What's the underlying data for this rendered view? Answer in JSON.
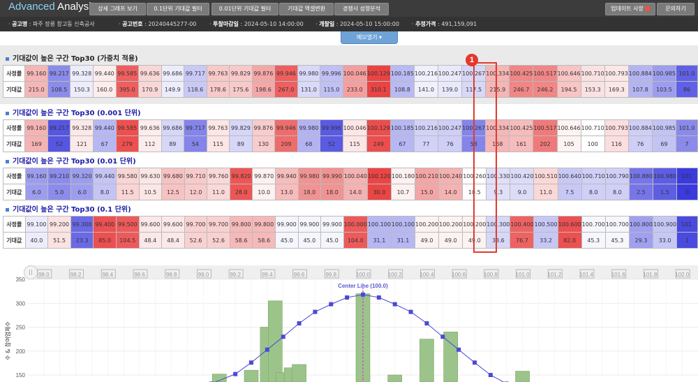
{
  "app": {
    "logo_a": "Advanced",
    "logo_b": " Analysis"
  },
  "nav": [
    {
      "label": "상세 그래프 보기"
    },
    {
      "label": "0.1단위 기대값 필터"
    },
    {
      "label": "0.01단위 기대값 필터"
    },
    {
      "label": "기대값 엑셀변환"
    },
    {
      "label": "경쟁사 성향분석"
    }
  ],
  "nav_right": [
    {
      "label": "업데이트 사항"
    },
    {
      "label": "문의하기"
    }
  ],
  "info": [
    {
      "k": "공고명",
      "v": "파주 장릉 창고동 신축공사"
    },
    {
      "k": "공고번호",
      "v": "20240445277-00"
    },
    {
      "k": "투찰마감일",
      "v": "2024-05-10 14:00:00"
    },
    {
      "k": "개찰일",
      "v": "2024-05-10 15:00:00"
    },
    {
      "k": "추정가격",
      "v": "491,159,091"
    }
  ],
  "memo": "메모열기",
  "row_labels": {
    "rate": "사정률",
    "exp": "기대값"
  },
  "sections": [
    {
      "title": "기대값이 높은 구간 Top30 (가중치 적용)",
      "blue": false,
      "rates": [
        "99.160",
        "99.217",
        "99.328",
        "99.440",
        "99.585",
        "99.636",
        "99.686",
        "99.717",
        "99.763",
        "99.829",
        "99.876",
        "99.946",
        "99.980",
        "99.996",
        "100.046",
        "100.129",
        "100.185",
        "100.216",
        "100.247",
        "100.267",
        "100.334",
        "100.425",
        "100.517",
        "100.646",
        "100.710",
        "100.793",
        "100.884",
        "100.985",
        "101.0"
      ],
      "exps": [
        "215.0",
        "108.5",
        "150.3",
        "160.0",
        "395.0",
        "170.9",
        "149.9",
        "118.6",
        "178.6",
        "175.6",
        "198.6",
        "267.0",
        "131.0",
        "115.0",
        "233.0",
        "310.1",
        "108.8",
        "141.0",
        "139.0",
        "117.5",
        "215.9",
        "246.7",
        "246.2",
        "194.5",
        "153.3",
        "169.3",
        "107.8",
        "103.5",
        "86"
      ],
      "colors": [
        "#f4b6b6",
        "#8b8bea",
        "#ececfc",
        "#fcecec",
        "#ee5f5f",
        "#f9d7d7",
        "#ececfc",
        "#c9c9f7",
        "#f8c9c9",
        "#f8c9c9",
        "#f4a7a7",
        "#ee5f5f",
        "#d9d9f9",
        "#c0c0f5",
        "#f49e9e",
        "#e94444",
        "#b9b9f4",
        "#f0f0fd",
        "#e9e9fc",
        "#d7d7f8",
        "#f4b6b6",
        "#f08686",
        "#f08686",
        "#f8c4c4",
        "#f9e2e2",
        "#fbe7e7",
        "#b4b4f3",
        "#9d9df0",
        "#6060e6"
      ]
    },
    {
      "title": "기대값이 높은 구간 Top30 (0.001 단위)",
      "blue": true,
      "rates": [
        "99.160",
        "99.217",
        "99.328",
        "99.440",
        "99.585",
        "99.636",
        "99.686",
        "99.717",
        "99.763",
        "99.829",
        "99.876",
        "99.946",
        "99.980",
        "99.996",
        "100.046",
        "100.129",
        "100.185",
        "100.216",
        "100.247",
        "100.267",
        "100.334",
        "100.425",
        "100.517",
        "100.646",
        "100.710",
        "100.793",
        "100.884",
        "100.985",
        "101.0"
      ],
      "exps": [
        "169",
        "52",
        "121",
        "67",
        "279",
        "112",
        "89",
        "54",
        "115",
        "89",
        "130",
        "209",
        "68",
        "52",
        "115",
        "249",
        "67",
        "77",
        "76",
        "58",
        "168",
        "161",
        "202",
        "105",
        "100",
        "116",
        "76",
        "69",
        "7"
      ],
      "colors": [
        "#f5b3b3",
        "#5656e2",
        "#fbe9e9",
        "#b7b7f3",
        "#ee4f4f",
        "#fcecec",
        "#d6d6f8",
        "#8484eb",
        "#fde6e6",
        "#d6d6f8",
        "#f8cccc",
        "#ef6c6c",
        "#b3b3f3",
        "#5a5ae3",
        "#fde6e6",
        "#ec4d4d",
        "#b7b7f3",
        "#d2d2f8",
        "#cecef7",
        "#8484eb",
        "#f5b7b7",
        "#f6bcbc",
        "#f07a7a",
        "#fdf3f3",
        "#ffffff",
        "#fcdede",
        "#cecef7",
        "#c3c3f5",
        "#8a8aea"
      ]
    },
    {
      "title": "기대값이 높은 구간 Top30 (0.01 단위)",
      "blue": true,
      "rates": [
        "99.160",
        "99.210",
        "99.320",
        "99.440",
        "99.580",
        "99.630",
        "99.680",
        "99.710",
        "99.760",
        "99.820",
        "99.870",
        "99.940",
        "99.980",
        "99.990",
        "100.040",
        "100.120",
        "100.180",
        "100.210",
        "100.240",
        "100.260",
        "100.330",
        "100.420",
        "100.510",
        "100.640",
        "100.710",
        "100.790",
        "100.880",
        "100.980",
        "101."
      ],
      "exps": [
        "6.0",
        "5.0",
        "6.0",
        "8.0",
        "11.5",
        "10.5",
        "12.5",
        "12.0",
        "11.0",
        "28.0",
        "10.0",
        "13.0",
        "18.0",
        "18.0",
        "14.0",
        "30.0",
        "10.7",
        "15.0",
        "14.0",
        "10.5",
        "9.3",
        "9.0",
        "11.0",
        "7.5",
        "8.0",
        "8.0",
        "2.5",
        "1.5",
        "0"
      ],
      "colors": [
        "#9d9def",
        "#8c8cec",
        "#9d9def",
        "#c4c4f5",
        "#f9d5d5",
        "#fbe6e6",
        "#f7c2c2",
        "#f8caca",
        "#fad8d8",
        "#ee5555",
        "#fdf1f1",
        "#f7bcbc",
        "#f19393",
        "#f19393",
        "#f5b2b2",
        "#eb4545",
        "#fdf0f0",
        "#f4a6a6",
        "#f5b2b2",
        "#ffffff",
        "#e0e0fa",
        "#dcdcf9",
        "#fad8d8",
        "#c8c8f6",
        "#cfcff7",
        "#cfcff7",
        "#7676e9",
        "#5e5ee4",
        "#3a3ade"
      ]
    },
    {
      "title": "기대값이 높은 구간 Top30 (0.1 단위)",
      "blue": true,
      "rates": [
        "99.100",
        "99.200",
        "99.300",
        "99.400",
        "99.500",
        "99.600",
        "99.600",
        "99.700",
        "99.700",
        "99.800",
        "99.800",
        "99.900",
        "99.900",
        "99.900",
        "100.000",
        "100.100",
        "100.100",
        "100.200",
        "100.200",
        "100.200",
        "100.300",
        "100.400",
        "100.500",
        "100.600",
        "100.700",
        "100.700",
        "100.800",
        "100.900",
        "101."
      ],
      "exps": [
        "40.0",
        "51.5",
        "23.3",
        "85.0",
        "104.5",
        "48.4",
        "48.4",
        "52.6",
        "52.6",
        "58.6",
        "58.6",
        "45.0",
        "45.0",
        "45.0",
        "104.0",
        "31.1",
        "31.1",
        "49.0",
        "49.0",
        "49.0",
        "38.6",
        "76.7",
        "33.2",
        "82.0",
        "45.3",
        "45.3",
        "29.3",
        "33.0",
        "1"
      ],
      "colors": [
        "#ececfc",
        "#fbe3e3",
        "#6a6ae6",
        "#ec5050",
        "#ee5a5a",
        "#fbe8e8",
        "#fbe8e8",
        "#f9d1d1",
        "#f9d1d1",
        "#f6b9b9",
        "#f6b9b9",
        "#f5f5fd",
        "#f5f5fd",
        "#f5f5fd",
        "#ee5a5a",
        "#b7b7f3",
        "#b7b7f3",
        "#fdf2f2",
        "#fdf2f2",
        "#fdf2f2",
        "#d7d7f8",
        "#ee6262",
        "#c7c7f6",
        "#ec5050",
        "#f6f6fd",
        "#f6f6fd",
        "#a0a0f0",
        "#c7c7f6",
        "#4a4ae0"
      ]
    }
  ],
  "badge": "1",
  "chart_data": {
    "type": "bar",
    "annotations": [
      "Center Line (100.0)"
    ],
    "ylim": [
      150,
      350
    ],
    "y_ticks": [
      "350",
      "300",
      "250",
      "200",
      "150"
    ],
    "mini_ticks": [
      "98.0",
      "98.2",
      "98.4",
      "98.6",
      "98.8",
      "99.0",
      "99.2",
      "99.4",
      "99.6",
      "99.8",
      "100.0",
      "100.2",
      "100.4",
      "100.6",
      "100.8",
      "101.0",
      "101.2",
      "101.4",
      "101.6",
      "101.8",
      "102.0"
    ],
    "ylabel_vertical": "수 & 참여업체수",
    "bars": [
      {
        "x": 99.1,
        "v": 152
      },
      {
        "x": 99.3,
        "v": 160
      },
      {
        "x": 99.4,
        "v": 250
      },
      {
        "x": 99.45,
        "v": 305
      },
      {
        "x": 99.5,
        "v": 155
      },
      {
        "x": 99.55,
        "v": 165
      },
      {
        "x": 99.6,
        "v": 172
      },
      {
        "x": 100.0,
        "v": 320
      },
      {
        "x": 100.2,
        "v": 150
      },
      {
        "x": 100.4,
        "v": 225
      },
      {
        "x": 100.55,
        "v": 240
      },
      {
        "x": 101.0,
        "v": 158
      }
    ],
    "line": [
      {
        "x": 98.9,
        "v": 118
      },
      {
        "x": 99.05,
        "v": 132
      },
      {
        "x": 99.2,
        "v": 152
      },
      {
        "x": 99.3,
        "v": 176
      },
      {
        "x": 99.4,
        "v": 203
      },
      {
        "x": 99.5,
        "v": 230
      },
      {
        "x": 99.6,
        "v": 258
      },
      {
        "x": 99.7,
        "v": 282
      },
      {
        "x": 99.8,
        "v": 298
      },
      {
        "x": 99.9,
        "v": 312
      },
      {
        "x": 100.0,
        "v": 318
      },
      {
        "x": 100.1,
        "v": 312
      },
      {
        "x": 100.2,
        "v": 298
      },
      {
        "x": 100.3,
        "v": 282
      },
      {
        "x": 100.4,
        "v": 258
      },
      {
        "x": 100.5,
        "v": 230
      },
      {
        "x": 100.6,
        "v": 203
      },
      {
        "x": 100.7,
        "v": 176
      },
      {
        "x": 100.8,
        "v": 150
      },
      {
        "x": 100.9,
        "v": 132
      }
    ]
  }
}
